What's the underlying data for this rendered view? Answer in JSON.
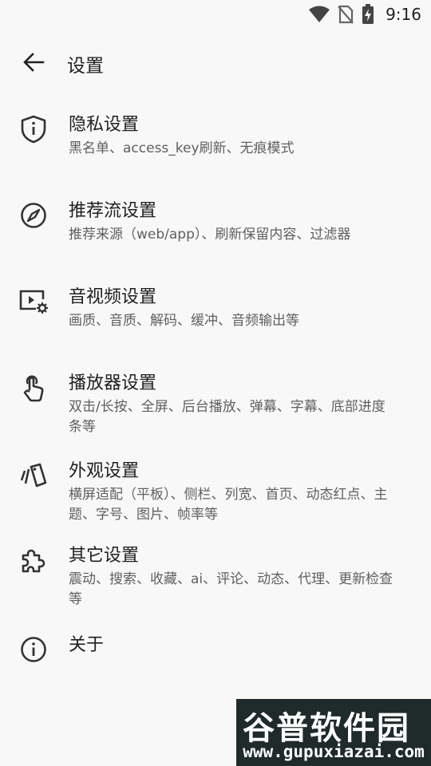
{
  "status_bar": {
    "time": "9:16",
    "icons": [
      "wifi-icon",
      "no-sim-icon",
      "battery-charging-icon"
    ]
  },
  "app_bar": {
    "title": "设置",
    "back_icon": "arrow-back-icon"
  },
  "settings": [
    {
      "title": "隐私设置",
      "subtitle": "黑名单、access_key刷新、无痕模式",
      "icon": "shield-info-icon"
    },
    {
      "title": "推荐流设置",
      "subtitle": "推荐来源（web/app）、刷新保留内容、过滤器",
      "icon": "compass-icon"
    },
    {
      "title": "音视频设置",
      "subtitle": "画质、音质、解码、缓冲、音频输出等",
      "icon": "video-settings-icon"
    },
    {
      "title": "播放器设置",
      "subtitle": "双击/长按、全屏、后台播放、弹幕、字幕、底部进度条等",
      "icon": "touch-icon"
    },
    {
      "title": "外观设置",
      "subtitle": "横屏适配（平板）、侧栏、列宽、首页、动态红点、主题、字号、图片、帧率等",
      "icon": "style-icon"
    },
    {
      "title": "其它设置",
      "subtitle": "震动、搜索、收藏、ai、评论、动态、代理、更新检查等",
      "icon": "extension-icon"
    },
    {
      "title": "关于",
      "subtitle": "",
      "icon": "info-icon"
    }
  ],
  "watermark": {
    "title": "谷普软件园",
    "url": "www.gupuxiazai.com"
  },
  "colors": {
    "background": "#f8f8f8",
    "title_text": "#1f1f1f",
    "subtitle_text": "#5f5f5f",
    "watermark_green": "#8cc63f"
  }
}
